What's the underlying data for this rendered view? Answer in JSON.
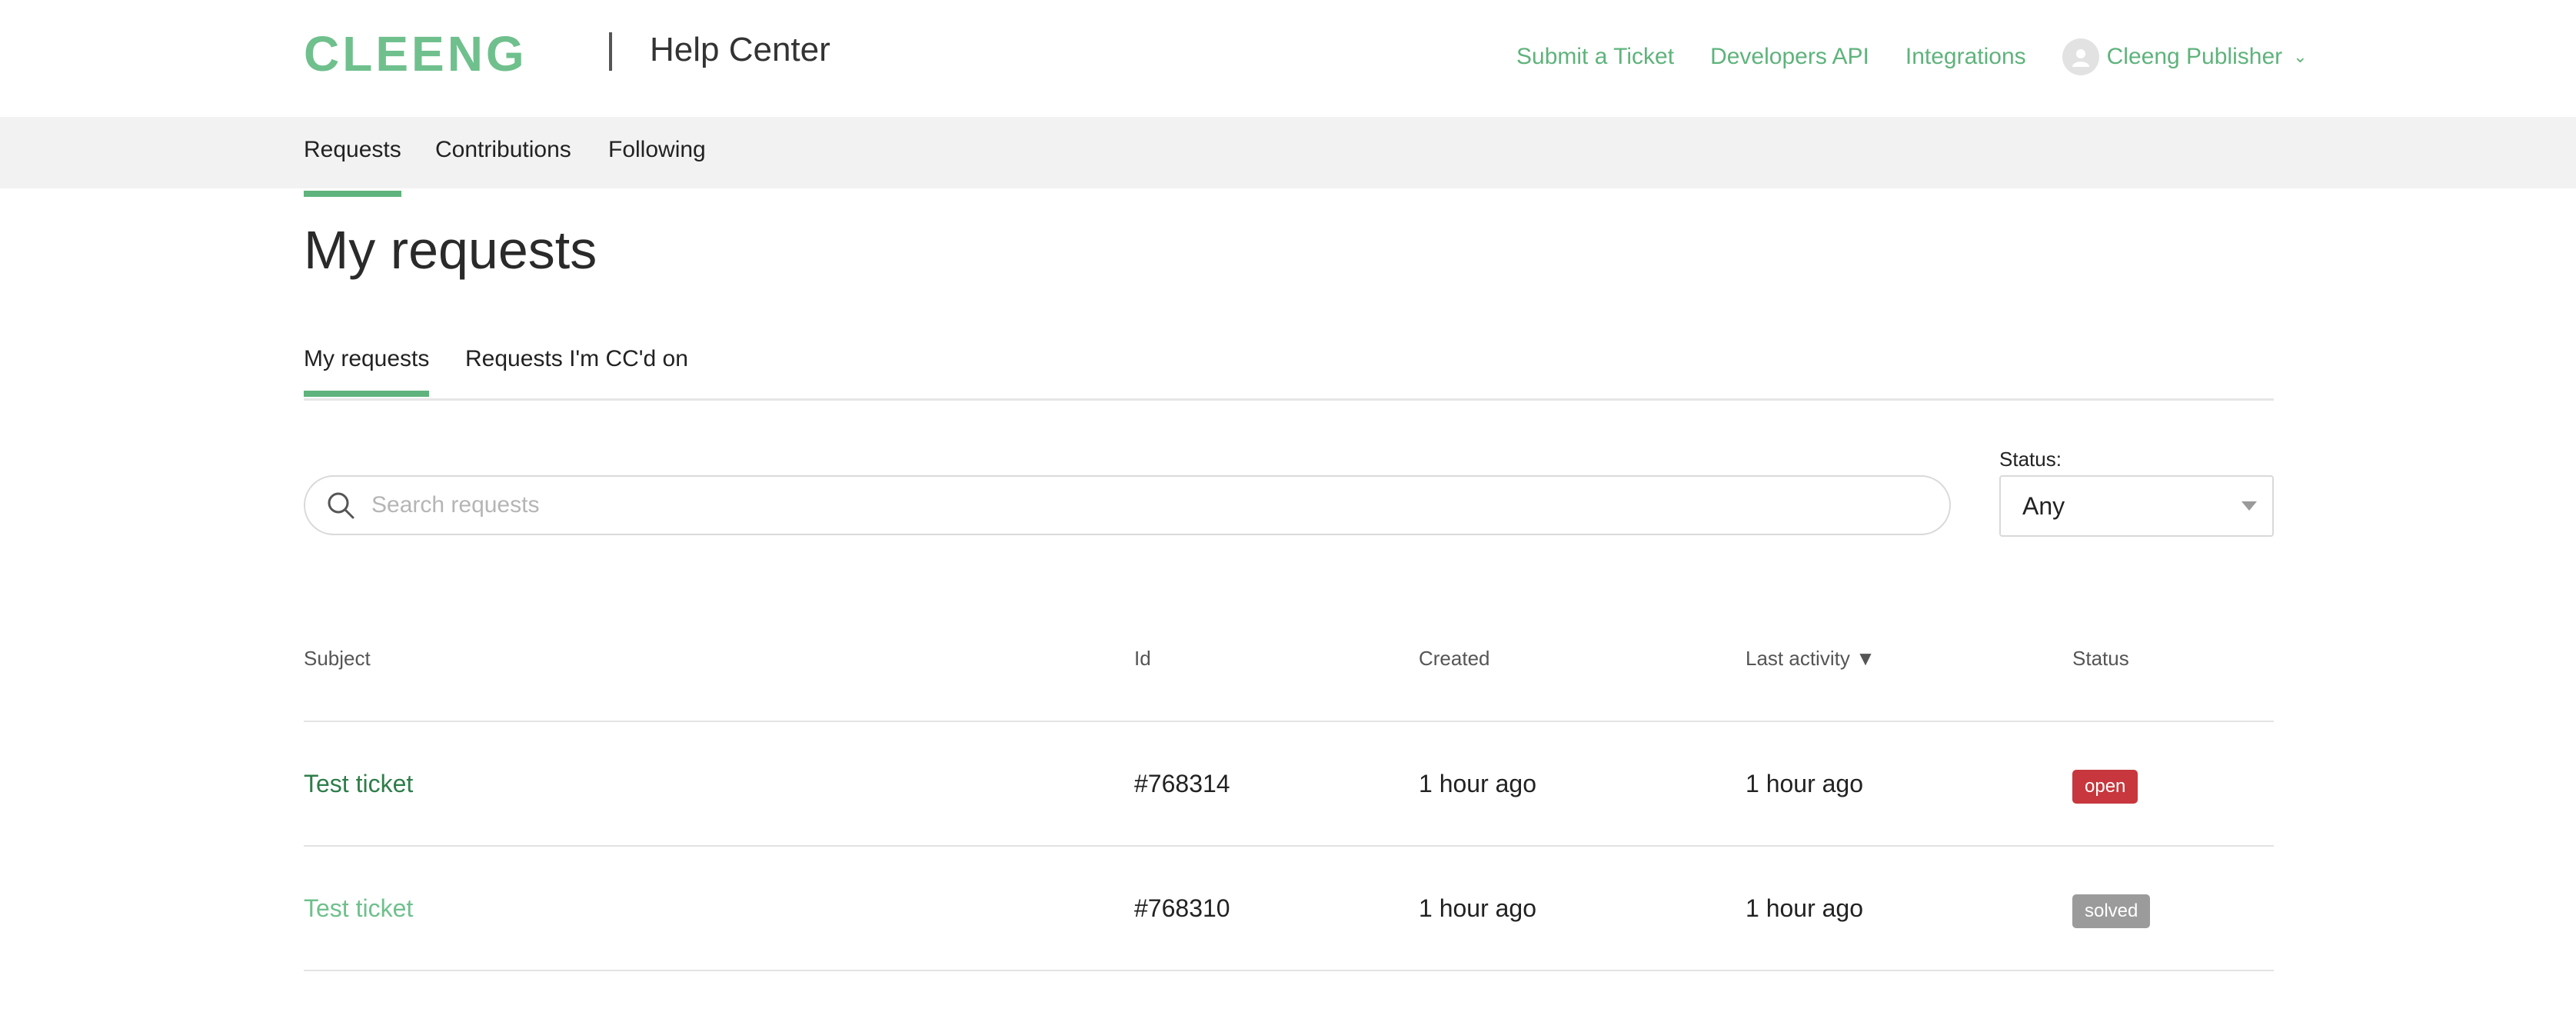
{
  "brand": {
    "logo_text": "CLEENG",
    "section_title": "Help Center",
    "accent": "#5fb37c"
  },
  "topnav": {
    "submit_ticket": "Submit a Ticket",
    "developers_api": "Developers API",
    "integrations": "Integrations",
    "user_name": "Cleeng Publisher"
  },
  "subnav": {
    "requests": "Requests",
    "contributions": "Contributions",
    "following": "Following"
  },
  "page": {
    "title": "My requests"
  },
  "inner_tabs": {
    "my_requests": "My requests",
    "cc": "Requests I'm CC'd on"
  },
  "search": {
    "placeholder": "Search requests"
  },
  "status_filter": {
    "label": "Status:",
    "value": "Any"
  },
  "table": {
    "headers": {
      "subject": "Subject",
      "id": "Id",
      "created": "Created",
      "last_activity": "Last activity",
      "sort_indicator": "▼",
      "status": "Status"
    },
    "rows": [
      {
        "subject": "Test ticket",
        "id": "#768314",
        "created": "1 hour ago",
        "last_activity": "1 hour ago",
        "status": "open",
        "status_color": "#c7373d"
      },
      {
        "subject": "Test ticket",
        "id": "#768310",
        "created": "1 hour ago",
        "last_activity": "1 hour ago",
        "status": "solved",
        "status_color": "#9b9b9b"
      }
    ]
  }
}
